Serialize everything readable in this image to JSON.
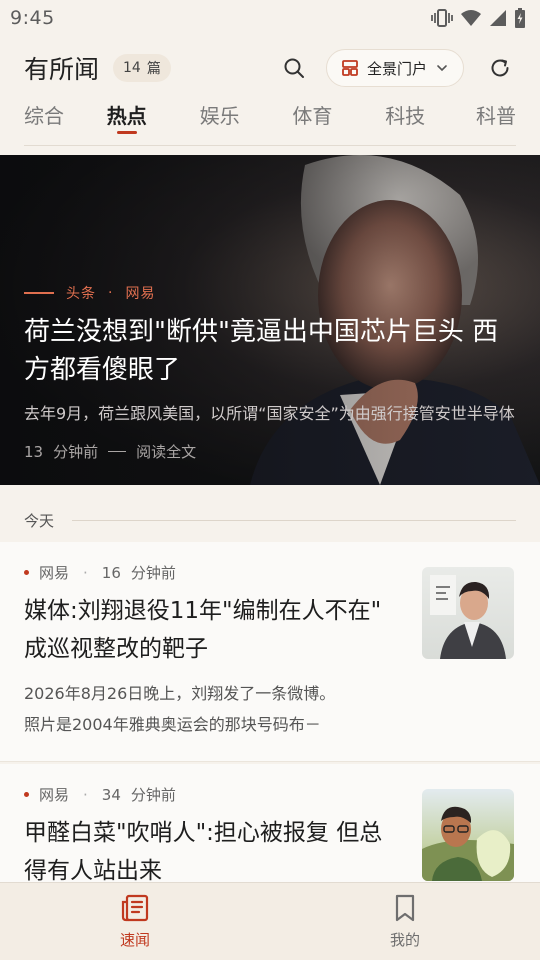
{
  "status_bar": {
    "time": "9:45"
  },
  "header": {
    "title": "有所闻",
    "count": "14",
    "count_unit": "篇",
    "portal_label": "全景门户"
  },
  "tabs": [
    {
      "label": "综合"
    },
    {
      "label": "热点"
    },
    {
      "label": "娱乐"
    },
    {
      "label": "体育"
    },
    {
      "label": "科技"
    },
    {
      "label": "科普"
    }
  ],
  "active_tab": "热点",
  "hero": {
    "tag": "头条",
    "source": "网易",
    "title": "荷兰没想到\"断供\"竟逼出中国芯片巨头 西方都看傻眼了",
    "summary": "去年9月，荷兰跟风美国，以所谓“国家安全”为由强行接管安世半导体",
    "time_value": "13",
    "time_unit": "分钟前",
    "read_more": "阅读全文"
  },
  "section": {
    "label": "今天"
  },
  "articles": [
    {
      "source": "网易",
      "time_value": "16",
      "time_unit": "分钟前",
      "title": "媒体:刘翔退役11年\"编制在人不在\" 成巡视整改的靶子",
      "summary_lines": [
        "2026年8月26日晚上，刘翔发了一条微博。",
        "照片是2004年雅典奥运会的那块号码布－"
      ]
    },
    {
      "source": "网易",
      "time_value": "34",
      "time_unit": "分钟前",
      "title": "甲醛白菜\"吹哨人\":担心被报复 但总得有人站出来"
    }
  ],
  "bottom_nav": [
    {
      "label": "速闻"
    },
    {
      "label": "我的"
    }
  ],
  "colors": {
    "accent": "#c0391f",
    "background": "#f6f2ec",
    "card": "#fbfaf8"
  }
}
